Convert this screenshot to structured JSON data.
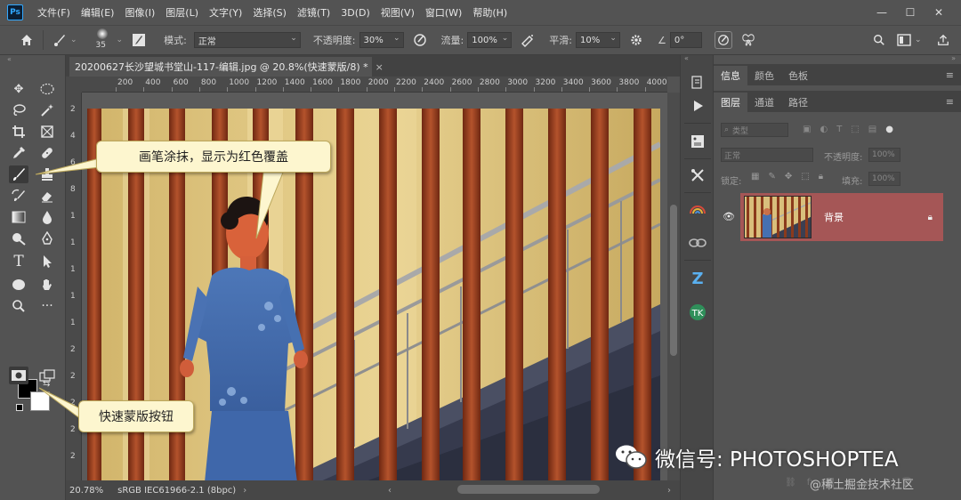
{
  "app": {
    "logo": "Ps"
  },
  "menu": [
    "文件(F)",
    "编辑(E)",
    "图像(I)",
    "图层(L)",
    "文字(Y)",
    "选择(S)",
    "滤镜(T)",
    "3D(D)",
    "视图(V)",
    "窗口(W)",
    "帮助(H)"
  ],
  "window_controls": {
    "minimize": "—",
    "restore": "☐",
    "close": "✕"
  },
  "options": {
    "brush_size": "35",
    "mode_label": "模式:",
    "mode_value": "正常",
    "opacity_label": "不透明度:",
    "opacity_value": "30%",
    "flow_label": "流量:",
    "flow_value": "100%",
    "smoothing_label": "平滑:",
    "smoothing_value": "10%",
    "angle_value": "0°"
  },
  "document": {
    "tab_title": "20200627长沙望城书堂山-117-编辑.jpg @ 20.8%(快速蒙版/8) *",
    "tab_close": "×"
  },
  "ruler_top": [
    "200",
    "400",
    "600",
    "800",
    "1000",
    "1200",
    "1400",
    "1600",
    "1800",
    "2000",
    "2200",
    "2400",
    "2600",
    "2800",
    "3000",
    "3200",
    "3400",
    "3600",
    "3800",
    "4000"
  ],
  "ruler_left": [
    "2",
    "4",
    "6",
    "8",
    "1",
    "1",
    "1",
    "1",
    "1",
    "2",
    "2",
    "2",
    "2",
    "2"
  ],
  "status": {
    "zoom": "20.78%",
    "profile": "sRGB IEC61966-2.1 (8bpc)"
  },
  "panels": {
    "top_tabs": [
      "信息",
      "颜色",
      "色板"
    ],
    "layer_tabs": [
      "图层",
      "通道",
      "路径"
    ],
    "menu_glyph": "≡",
    "filter_label": "类型",
    "blend_mode": "正常",
    "opacity_label": "不透明度:",
    "opacity_value": "100%",
    "lock_label": "锁定:",
    "fill_label": "填充:",
    "fill_value": "100%",
    "layer_name": "背景"
  },
  "callouts": {
    "brush": "画笔涂抹，显示为红色覆盖",
    "quickmask": "快速蒙版按钮"
  },
  "watermark": {
    "text": "微信号: PHOTOSHOPTEA",
    "site": "@稀土掘金技术社区"
  },
  "colors": {
    "layer_selected": "#a55656",
    "callout_bg": "#fdf6cf",
    "ui_bg": "#535353"
  }
}
